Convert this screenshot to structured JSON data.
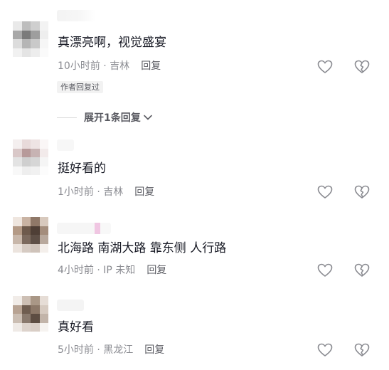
{
  "comments": [
    {
      "text": "真漂亮啊，视觉盛宴",
      "time": "10小时前",
      "location": "吉林",
      "reply": "回复",
      "badge": "作者回复过",
      "expand": "展开1条回复",
      "avatar_colors": [
        "#e9e9e9",
        "#bdbdbd",
        "#cfcfcf",
        "#f3f3f3",
        "#a8a8a8",
        "#7a7a7a",
        "#9e9e9e",
        "#eeeeee",
        "#dcdcdc",
        "#b5b5b5",
        "#c9c9c9",
        "#f6f6f6",
        "#f1f1f1",
        "#e4e4e4",
        "#ededed",
        "#fafafa"
      ]
    },
    {
      "text": "挺好看的",
      "time": "1小时前",
      "location": "吉林",
      "reply": "回复",
      "avatar_colors": [
        "#f4efef",
        "#e8dada",
        "#eee4e4",
        "#faf6f6",
        "#d9c8c8",
        "#b79a9a",
        "#c7b3b3",
        "#f2eaea",
        "#e3e3e3",
        "#cfcfcf",
        "#d6d6d6",
        "#f5f5f5",
        "#f8f8f8",
        "#eeeeee",
        "#f1f1f1",
        "#fcfcfc"
      ]
    },
    {
      "text": "北海路 南湖大路 靠东侧 人行路",
      "time": "4小时前",
      "location": "IP 未知",
      "reply": "回复",
      "avatar_colors": [
        "#efe6df",
        "#c9b3a3",
        "#8f7868",
        "#d8c9bd",
        "#b49a86",
        "#6e5a4c",
        "#4f3f36",
        "#a48d7c",
        "#c8b7aa",
        "#7c6a5e",
        "#5e4f46",
        "#b8a89c",
        "#ece4de",
        "#d6cbc3",
        "#cfc3ba",
        "#f4efeb"
      ]
    },
    {
      "text": "真好看",
      "time": "5小时前",
      "location": "黑龙江",
      "reply": "回复",
      "avatar_colors": [
        "#f1ece8",
        "#cdbfb4",
        "#a99786",
        "#e6ddd6",
        "#b8a393",
        "#6f5d50",
        "#8c7868",
        "#d6cac0",
        "#cbbeb3",
        "#8a7a6e",
        "#5d4d42",
        "#c2b4a9",
        "#efeae6",
        "#ddd3cc",
        "#d9cec6",
        "#f6f3f0"
      ]
    }
  ],
  "icons": [
    "heart-outline",
    "dislike-broken-heart"
  ]
}
